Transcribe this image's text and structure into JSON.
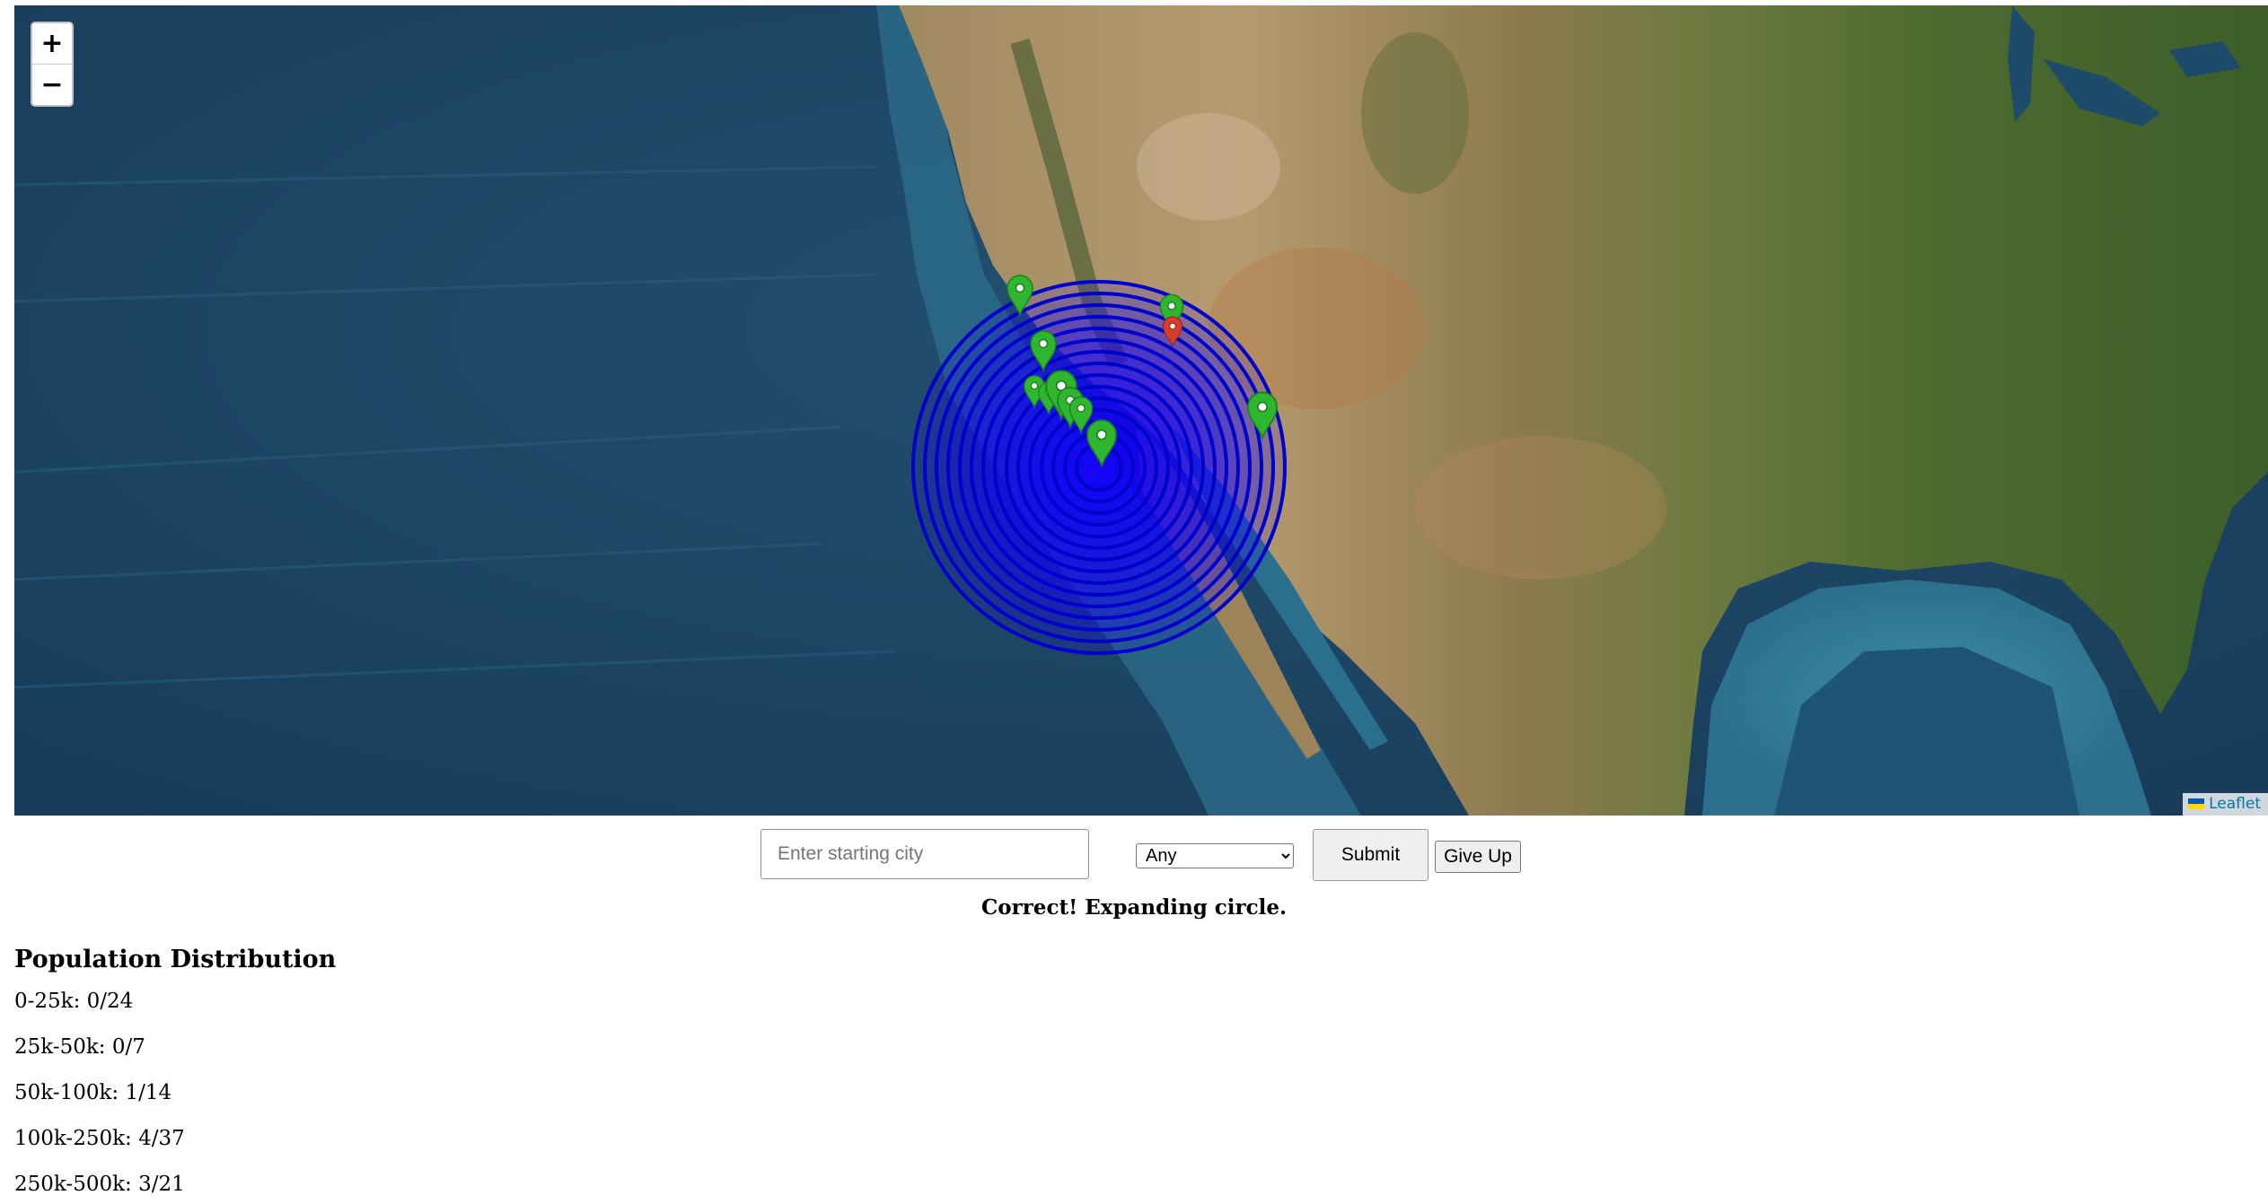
{
  "map": {
    "zoom_in_label": "+",
    "zoom_out_label": "−",
    "attribution": "Leaflet",
    "circle_color": "#0000ff",
    "marker_color_correct": "#2fb62f",
    "marker_color_target": "#d63e2a"
  },
  "controls": {
    "city_placeholder": "Enter starting city",
    "city_value": "",
    "population_selected": "Any",
    "submit_label": "Submit",
    "give_up_label": "Give Up"
  },
  "status": "Correct! Expanding circle.",
  "distribution": {
    "title": "Population Distribution",
    "rows": [
      "0-25k: 0/24",
      "25k-50k: 0/7",
      "50k-100k: 1/14",
      "100k-250k: 4/37",
      "250k-500k: 3/21"
    ]
  }
}
